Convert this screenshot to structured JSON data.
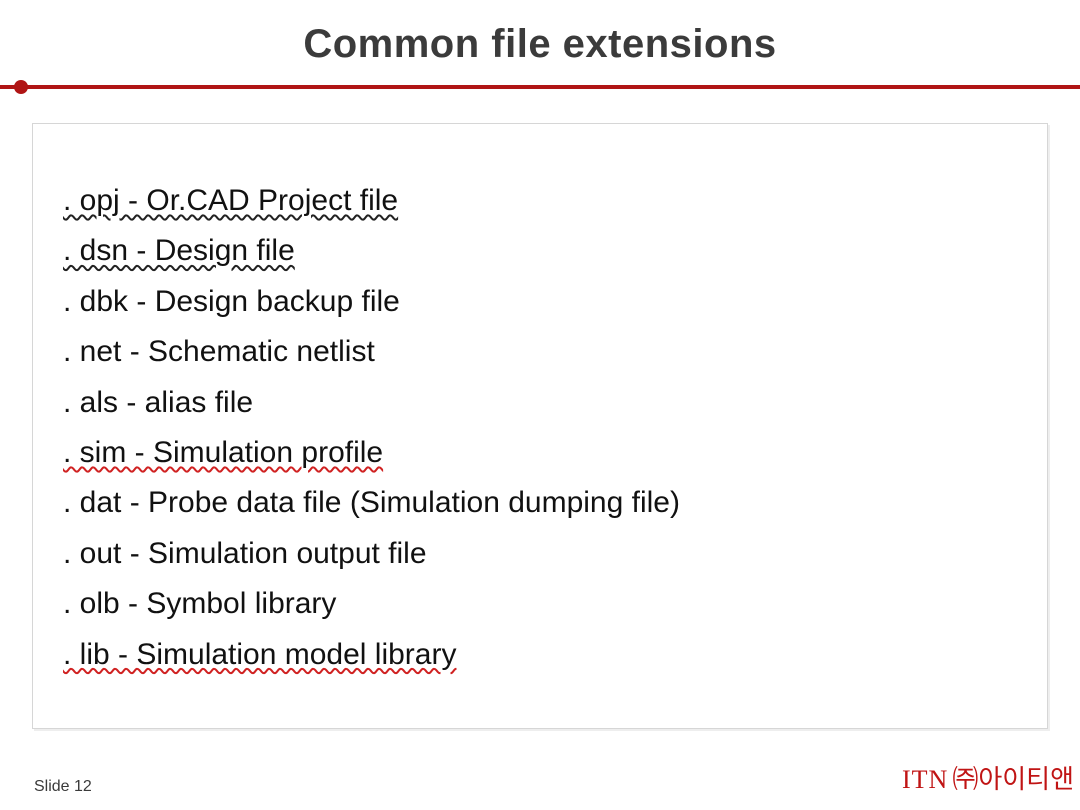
{
  "title": "Common file extensions",
  "items": [
    {
      "text": ". opj - Or.CAD Project file",
      "style": "squiggle-black"
    },
    {
      "text": ". dsn - Design file",
      "style": "squiggle-black"
    },
    {
      "text": ". dbk - Design backup file",
      "style": ""
    },
    {
      "text": ". net - Schematic netlist",
      "style": ""
    },
    {
      "text": ". als - alias file",
      "style": ""
    },
    {
      "text": ". sim - Simulation profile",
      "style": "squiggle-red"
    },
    {
      "text": ". dat - Probe data file (Simulation dumping file)",
      "style": ""
    },
    {
      "text": ". out - Simulation output file",
      "style": ""
    },
    {
      "text": ". olb - Symbol library",
      "style": ""
    },
    {
      "text": ". lib - Simulation model library",
      "style": "squiggle-red"
    }
  ],
  "footer": {
    "slide_label": "Slide 12",
    "brand_itn": "ITN",
    "brand_kr": "㈜아이티앤"
  }
}
